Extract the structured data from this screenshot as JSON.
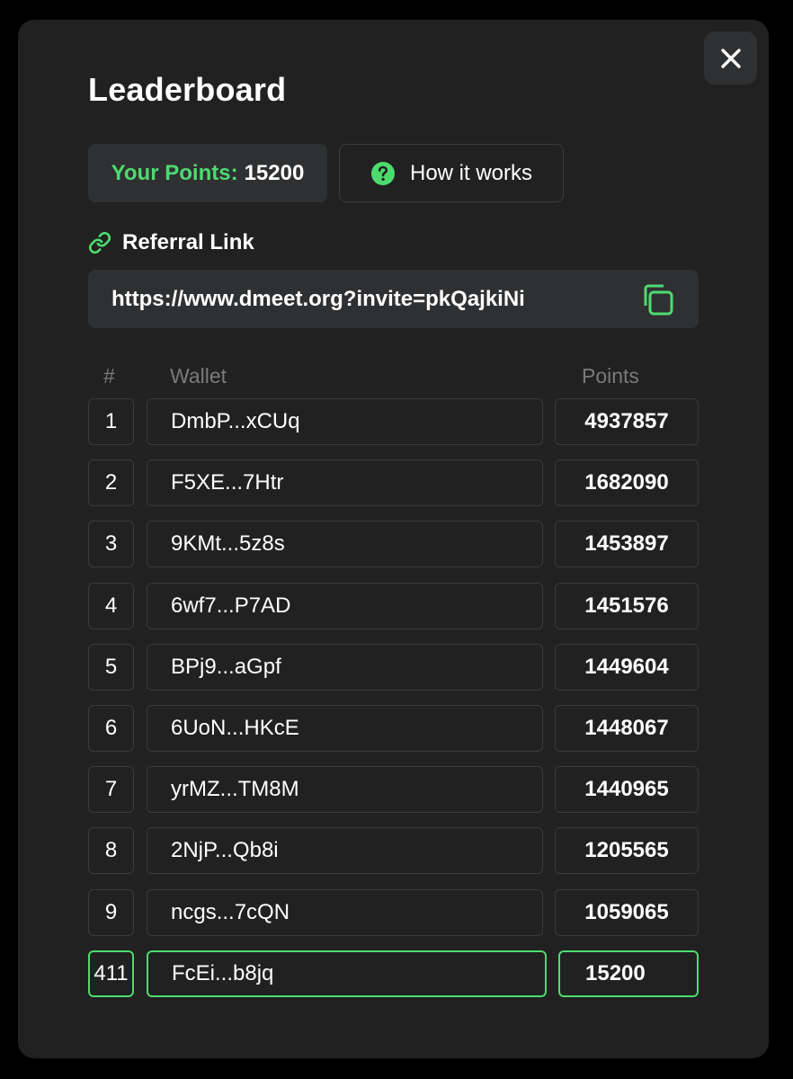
{
  "modal": {
    "title": "Leaderboard",
    "close_icon": "close-icon"
  },
  "points": {
    "label": "Your Points:",
    "value": "15200"
  },
  "how_it_works": {
    "label": "How it works",
    "icon": "question-circle-icon"
  },
  "referral": {
    "label": "Referral Link",
    "icon": "link-icon",
    "url": "https://www.dmeet.org?invite=pkQajkiNi",
    "copy_icon": "copy-icon"
  },
  "table": {
    "headers": {
      "rank": "#",
      "wallet": "Wallet",
      "points": "Points"
    },
    "rows": [
      {
        "rank": "1",
        "wallet": "DmbP...xCUq",
        "points": "4937857"
      },
      {
        "rank": "2",
        "wallet": "F5XE...7Htr",
        "points": "1682090"
      },
      {
        "rank": "3",
        "wallet": "9KMt...5z8s",
        "points": "1453897"
      },
      {
        "rank": "4",
        "wallet": "6wf7...P7AD",
        "points": "1451576"
      },
      {
        "rank": "5",
        "wallet": "BPj9...aGpf",
        "points": "1449604"
      },
      {
        "rank": "6",
        "wallet": "6UoN...HKcE",
        "points": "1448067"
      },
      {
        "rank": "7",
        "wallet": "yrMZ...TM8M",
        "points": "1440965"
      },
      {
        "rank": "8",
        "wallet": "2NjP...Qb8i",
        "points": "1205565"
      },
      {
        "rank": "9",
        "wallet": "ncgs...7cQN",
        "points": "1059065"
      }
    ],
    "current_user": {
      "rank": "411",
      "wallet": "FcEi...b8jq",
      "points": "15200"
    }
  },
  "colors": {
    "accent": "#4ddb70",
    "modal_bg": "#212121",
    "surface": "#2f3032",
    "border": "#3a3a3c",
    "muted_text": "#7a7a7c"
  }
}
